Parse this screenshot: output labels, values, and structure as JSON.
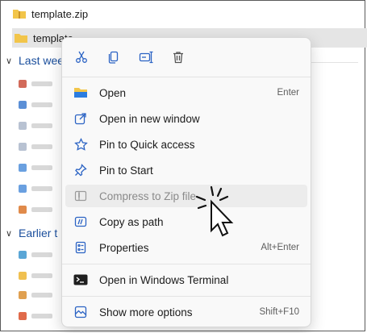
{
  "explorer": {
    "zip_name": "template.zip",
    "folder_name": "template",
    "group_last_week": "Last wee",
    "group_earlier": "Earlier t"
  },
  "toolbar": {
    "cut_icon": "scissors-icon",
    "copy_icon": "copy-icon",
    "rename_icon": "rename-icon",
    "delete_icon": "trash-icon"
  },
  "menu": {
    "open_label": "Open",
    "open_key": "Enter",
    "open_new_window_label": "Open in new window",
    "pin_quick_label": "Pin to Quick access",
    "pin_start_label": "Pin to Start",
    "compress_label": "Compress to Zip file",
    "copy_path_label": "Copy as path",
    "properties_label": "Properties",
    "properties_key": "Alt+Enter",
    "terminal_label": "Open in Windows Terminal",
    "more_options_label": "Show more options",
    "more_options_key": "Shift+F10"
  }
}
